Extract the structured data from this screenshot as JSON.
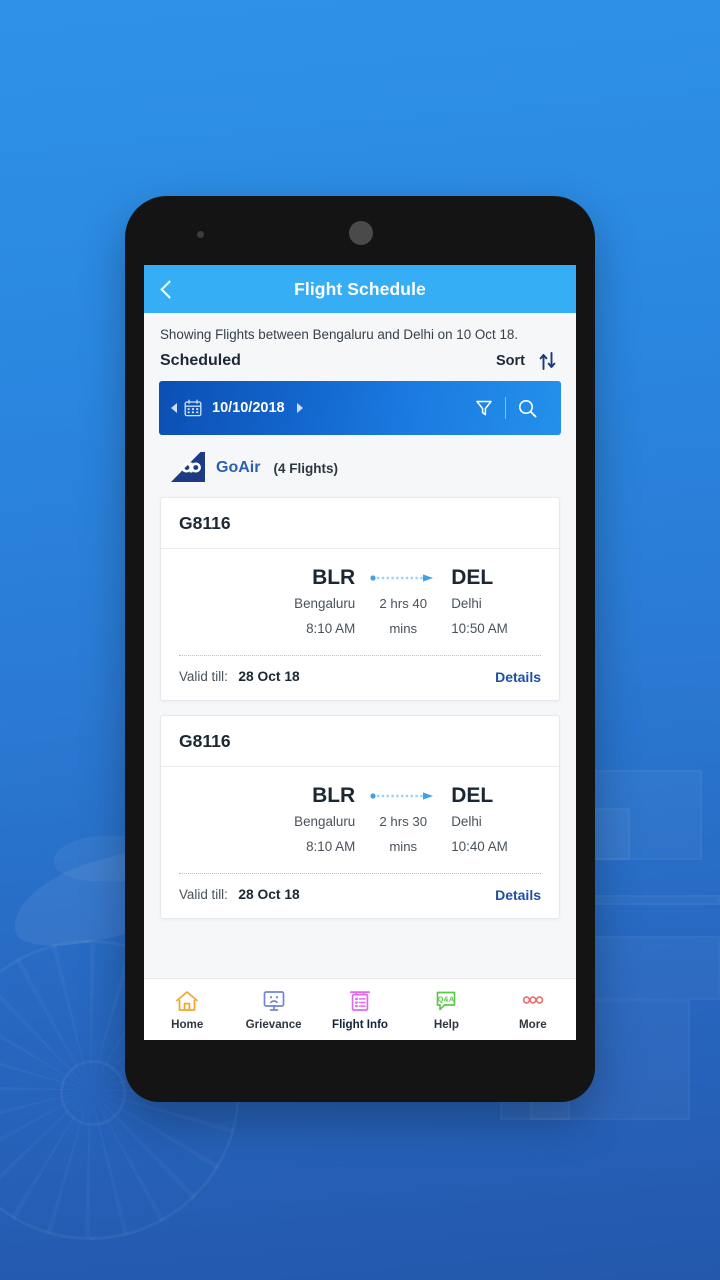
{
  "device": {
    "sensor_icon": "proximity-sensor",
    "camera_icon": "front-camera"
  },
  "header": {
    "back_icon": "back-chevron-icon",
    "title": "Flight Schedule",
    "bg_color": "#35aef5"
  },
  "content": {
    "showing_text": "Showing Flights between Bengaluru and Delhi on 10 Oct 18.",
    "scheduled_label": "Scheduled",
    "sort_label": "Sort",
    "sort_icon": "sort-arrows-icon"
  },
  "date_bar": {
    "prev_icon": "prev-arrow-icon",
    "calendar_icon": "calendar-icon",
    "date": "10/10/2018",
    "next_icon": "next-arrow-icon",
    "filter_icon": "filter-icon",
    "search_icon": "search-icon",
    "gradient_from": "#0b4fb4",
    "gradient_to": "#2490ec"
  },
  "airline": {
    "logo_icon": "goair-tail-logo",
    "name": "GoAir",
    "name_color": "#2a5eb5",
    "flights_count": "(4 Flights)"
  },
  "flights": [
    {
      "flight_no": "G8116",
      "from_code": "BLR",
      "from_city": "Bengaluru",
      "from_time": "8:10 AM",
      "duration_1": "2 hrs 40",
      "duration_2": "mins",
      "to_code": "DEL",
      "to_city": "Delhi",
      "to_time": "10:50 AM",
      "valid_label": "Valid till:",
      "valid_date": "28 Oct 18",
      "details_label": "Details"
    },
    {
      "flight_no": "G8116",
      "from_code": "BLR",
      "from_city": "Bengaluru",
      "from_time": "8:10 AM",
      "duration_1": "2 hrs 30",
      "duration_2": "mins",
      "to_code": "DEL",
      "to_city": "Delhi",
      "to_time": "10:40 AM",
      "valid_label": "Valid till:",
      "valid_date": "28 Oct 18",
      "details_label": "Details"
    }
  ],
  "bottom_nav": {
    "items": [
      {
        "label": "Home",
        "icon": "home-icon",
        "color": "#f0a830",
        "active": false
      },
      {
        "label": "Grievance",
        "icon": "grievance-icon",
        "color": "#7286d3",
        "active": false
      },
      {
        "label": "Flight Info",
        "icon": "flight-info-icon",
        "color": "#e269e8",
        "active": true
      },
      {
        "label": "Help",
        "icon": "help-qa-icon",
        "color": "#5cc94c",
        "active": false
      },
      {
        "label": "More",
        "icon": "more-dots-icon",
        "color": "#f06b6b",
        "active": false
      }
    ]
  }
}
